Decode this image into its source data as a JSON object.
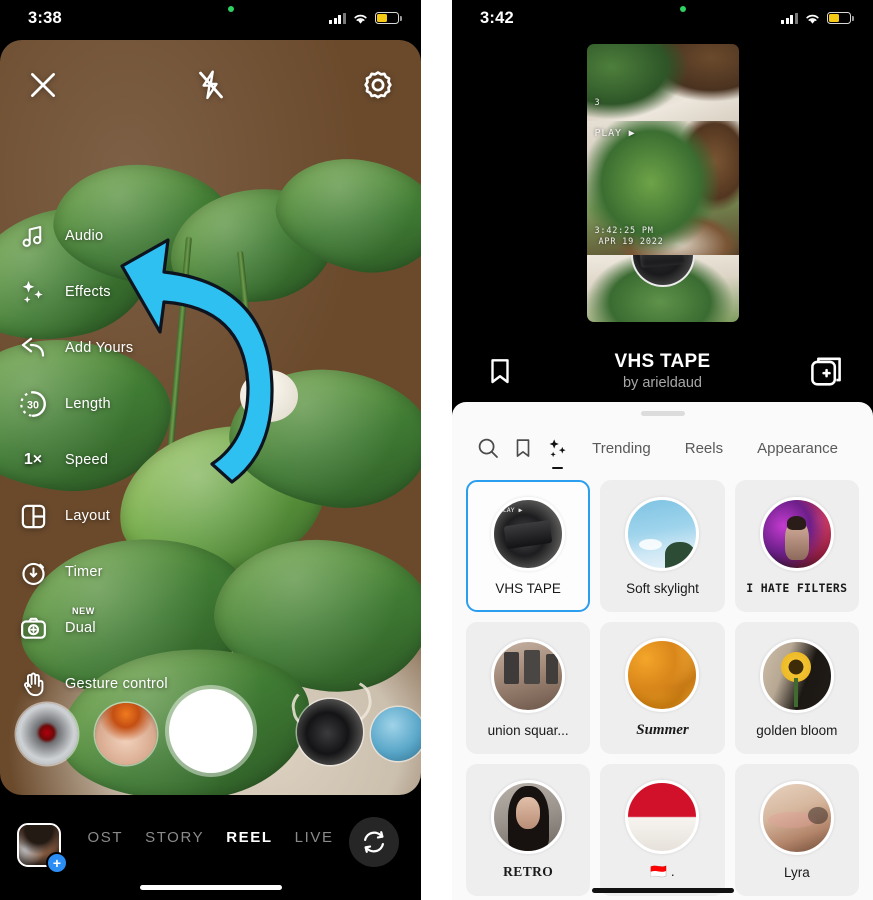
{
  "left_phone": {
    "status_bar": {
      "time": "3:38",
      "signal_icon": "cellular-bars-icon",
      "wifi_icon": "wifi-icon",
      "battery_icon": "battery-icon"
    },
    "camera_top_bar": {
      "close_label": "close-icon",
      "flash_label": "flash-off-icon",
      "settings_label": "settings-gear-icon"
    },
    "tools": [
      {
        "label": "Audio",
        "icon": "music-note-icon"
      },
      {
        "label": "Effects",
        "icon": "sparkles-icon"
      },
      {
        "label": "Add Yours",
        "icon": "arrow-return-icon"
      },
      {
        "label": "Length",
        "icon": "timer-30-icon",
        "value": "30"
      },
      {
        "label": "Speed",
        "icon": "speed-icon",
        "value": "1×"
      },
      {
        "label": "Layout",
        "icon": "layout-grid-icon"
      },
      {
        "label": "Timer",
        "icon": "timer-icon"
      },
      {
        "label": "Dual",
        "icon": "dual-camera-icon",
        "badge": "NEW"
      },
      {
        "label": "Gesture control",
        "icon": "hand-icon"
      }
    ],
    "annotation": {
      "name": "blue-curved-arrow",
      "points_to": "Effects",
      "color": "#2fc0f2"
    },
    "effect_carousel": [
      {
        "name": "red-eye-effect-thumb"
      },
      {
        "name": "face-paint-effect-thumb"
      },
      {
        "name": "vhs-tape-effect-thumb"
      },
      {
        "name": "blue-orb-effect-thumb"
      }
    ],
    "shutter_button": "shutter-button",
    "modes": [
      {
        "label": "OST",
        "active": false,
        "clipped": true
      },
      {
        "label": "STORY",
        "active": false,
        "clipped": false
      },
      {
        "label": "REEL",
        "active": true,
        "clipped": false
      },
      {
        "label": "LIVE",
        "active": false,
        "clipped": false
      }
    ],
    "gallery_button": {
      "name": "gallery-avatar-button",
      "badge": "+"
    },
    "flip_camera_button": "flip-camera-icon"
  },
  "right_phone": {
    "status_bar": {
      "time": "3:42",
      "signal_icon": "cellular-bars-icon",
      "wifi_icon": "wifi-icon",
      "battery_icon": "battery-icon"
    },
    "preview": {
      "overlay_play": "PLAY ▶",
      "overlay_time": "3:42:25 PM",
      "overlay_date": "APR 19 2022",
      "overlay_corner": "3"
    },
    "effect_header": {
      "title": "VHS TAPE",
      "author": "by arieldaud",
      "save_icon": "bookmark-icon",
      "add_icon": "add-to-collection-icon"
    },
    "sheet": {
      "tabs": [
        {
          "label": "",
          "icon": "search-icon",
          "type": "icon",
          "selected": false
        },
        {
          "label": "",
          "icon": "bookmark-icon",
          "type": "icon",
          "selected": false
        },
        {
          "label": "",
          "icon": "sparkles-icon",
          "type": "icon",
          "selected": true
        },
        {
          "label": "Trending",
          "icon": "",
          "type": "text",
          "selected": false
        },
        {
          "label": "Reels",
          "icon": "",
          "type": "text",
          "selected": false
        },
        {
          "label": "Appearance",
          "icon": "",
          "type": "text",
          "selected": false
        }
      ],
      "effects": [
        {
          "name": "VHS TAPE",
          "style": "plain",
          "selected": true,
          "thumb": "vhs-tape"
        },
        {
          "name": "Soft skylight",
          "style": "plain",
          "selected": false,
          "thumb": "sky"
        },
        {
          "name": "I HATE FILTERS",
          "style": "mono",
          "selected": false,
          "thumb": "person-neon"
        },
        {
          "name": "union squar...",
          "style": "plain",
          "selected": false,
          "thumb": "building"
        },
        {
          "name": "Summer",
          "style": "ital",
          "selected": false,
          "thumb": "flowers"
        },
        {
          "name": "golden bloom",
          "style": "plain",
          "selected": false,
          "thumb": "sunflower"
        },
        {
          "name": "RETRO",
          "style": "serif",
          "selected": false,
          "thumb": "portrait"
        },
        {
          "name": "🇮🇩 .",
          "style": "plain",
          "selected": false,
          "thumb": "red-white"
        },
        {
          "name": "Lyra",
          "style": "plain",
          "selected": false,
          "thumb": "pastel"
        }
      ]
    }
  },
  "colors": {
    "accent_blue": "#2b9ef0",
    "annotation_blue": "#2fc0f2",
    "sheet_background": "#fafafa",
    "cell_background": "#eeeeee",
    "battery_yellow": "#f7ca16"
  }
}
